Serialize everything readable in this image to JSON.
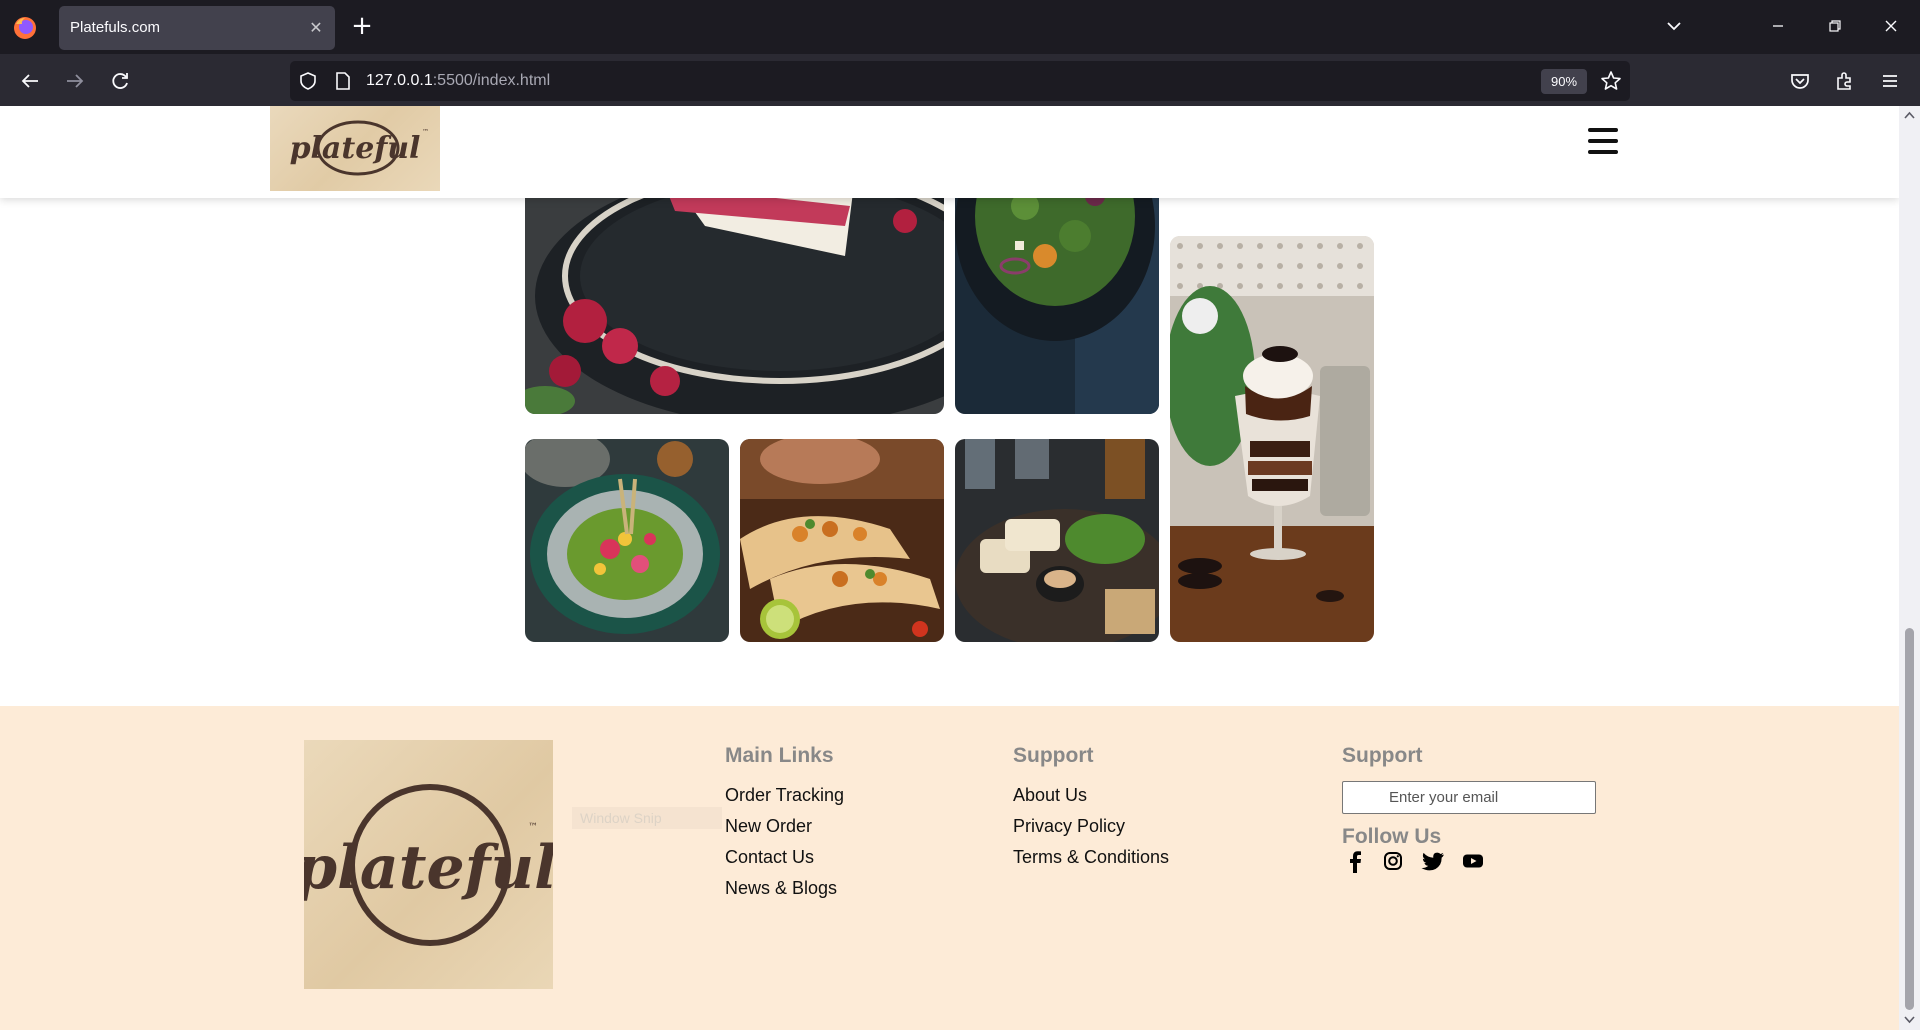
{
  "browser": {
    "tab_title": "Platefuls.com",
    "url_host": "127.0.0.1",
    "url_rest": ":5500/index.html",
    "zoom": "90%",
    "icons": [
      "firefox-icon",
      "close-icon",
      "plus-icon",
      "chevron-down-icon",
      "minimize-icon",
      "restore-icon",
      "window-close-icon",
      "back-icon",
      "forward-icon",
      "reload-icon",
      "shield-icon",
      "page-icon",
      "star-icon",
      "pocket-icon",
      "extensions-icon",
      "menu-icon"
    ]
  },
  "site": {
    "logo_text": "plateful",
    "logo_mark": "™"
  },
  "gallery": {
    "items": [
      "raspberry-cake",
      "green-salad",
      "dessert-partial",
      "oreo-parfait",
      "floral-plate",
      "chickpea-tacos",
      "grilled-platter"
    ]
  },
  "footer": {
    "ghost_text": "Window Snip",
    "main_links": {
      "heading": "Main Links",
      "items": [
        "Order Tracking",
        "New Order",
        "Contact Us",
        "News & Blogs"
      ]
    },
    "support": {
      "heading": "Support",
      "items": [
        "About Us",
        "Privacy Policy",
        "Terms & Conditions"
      ]
    },
    "newsletter": {
      "heading": "Support",
      "placeholder": "Enter your email"
    },
    "follow": {
      "heading": "Follow Us",
      "icons": [
        "facebook-icon",
        "instagram-icon",
        "twitter-icon",
        "youtube-icon"
      ]
    }
  },
  "colors": {
    "footer_bg": "#fdebd7",
    "logo_brown": "#4a352c",
    "chrome_dark": "#1c1b22"
  }
}
